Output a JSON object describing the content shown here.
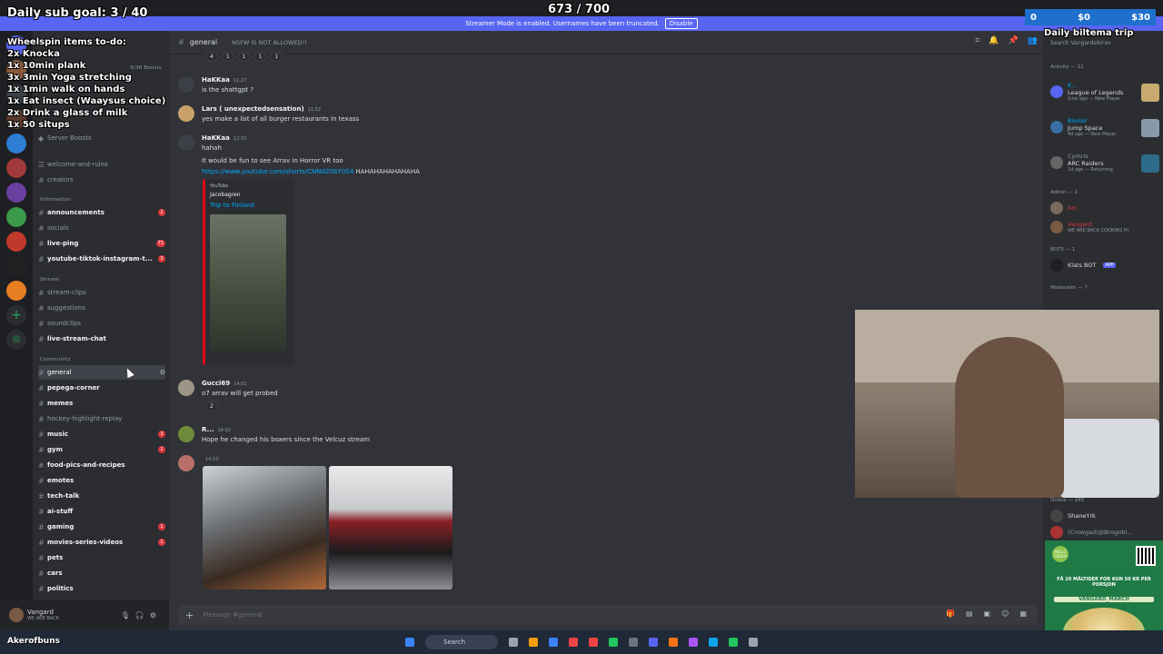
{
  "overlay": {
    "sub_goal": "Daily sub goal: 3 / 40",
    "counter": "673 / 700",
    "trip": "Daily biltema trip",
    "donate": [
      "0",
      "$0",
      "$30"
    ],
    "todo": [
      "Wheelspin items to-do:",
      "2x Knocka",
      "1x 10min plank",
      "3x 3min Yoga stretching",
      "1x 1min walk on hands",
      "1x Eat insect (Waaysus choice)",
      "2x Drink a glass of milk",
      "1x 50 situps"
    ],
    "bottom_name": "Akerofbuns"
  },
  "streamer_bar": {
    "text": "Streamer Mode is enabled. Usernames have been truncated.",
    "button": "Disable"
  },
  "sidebar": {
    "boosts": "Server Boosts",
    "boost_count": "9/36 Boosts",
    "top_channels": [
      "welcome-and-rules",
      "creators"
    ],
    "categories": {
      "information": "Information",
      "stream": "Stream",
      "community": "Community"
    },
    "information": [
      {
        "label": "announcements",
        "badge": "2"
      },
      {
        "label": "socials",
        "badge": ""
      },
      {
        "label": "live-ping",
        "badge": "71"
      },
      {
        "label": "youtube-tiktok-instagram-t...",
        "badge": "3"
      }
    ],
    "stream": [
      {
        "label": "stream-clips",
        "badge": ""
      },
      {
        "label": "suggestions",
        "badge": ""
      },
      {
        "label": "soundclips",
        "badge": ""
      },
      {
        "label": "live-stream-chat",
        "badge": ""
      }
    ],
    "community": [
      {
        "label": "general",
        "badge": ""
      },
      {
        "label": "pepega-corner",
        "badge": ""
      },
      {
        "label": "memes",
        "badge": ""
      },
      {
        "label": "hockey-highlight-replay",
        "badge": ""
      },
      {
        "label": "music",
        "badge": "3"
      },
      {
        "label": "gym",
        "badge": "1"
      },
      {
        "label": "food-pics-and-recipes",
        "badge": ""
      },
      {
        "label": "emotes",
        "badge": ""
      },
      {
        "label": "tech-talk",
        "badge": ""
      },
      {
        "label": "ai-stuff",
        "badge": ""
      },
      {
        "label": "gaming",
        "badge": "1"
      },
      {
        "label": "movies-series-videos",
        "badge": "1"
      },
      {
        "label": "pets",
        "badge": ""
      },
      {
        "label": "cars",
        "badge": ""
      },
      {
        "label": "politics",
        "badge": ""
      }
    ],
    "user": {
      "name": "Vangard",
      "status": "WE ARE BACK"
    }
  },
  "header": {
    "channel": "general",
    "topic": "NSFW IS NOT ALLOWED!!",
    "search": "Search VangardsArrav"
  },
  "top_reactions": [
    "4",
    "1",
    "1",
    "1",
    "1"
  ],
  "messages": [
    {
      "author": "HaKKaa",
      "time": "11:27",
      "text": "is the shattgpt ?"
    },
    {
      "author": "Lars ( unexpectedsensation)",
      "time": "11:52",
      "text": "yes make a list of all burger restaurants in texass"
    },
    {
      "author": "HaKKaa",
      "time": "12:33",
      "text": "hahah"
    },
    {
      "author": "",
      "time": "",
      "text": "It would be fun to see Arrav in Horror VR too"
    },
    {
      "author": "",
      "time": "",
      "text": "https://www.youtube.com/shorts/CNNdZ0bY0S4",
      "extra": "HAHAHAHAHAHAHA"
    },
    {
      "author": "Gucci69",
      "time": "14:01",
      "text": "o7 arrav will get probed"
    },
    {
      "author": "R...",
      "time": "14:02",
      "text": "Hope he changed his boxers since the Velcuz stream"
    },
    {
      "author": "",
      "time": "14:10",
      "text": ""
    }
  ],
  "embed": {
    "provider": "YouTube",
    "author": "Jacobagren",
    "title": "Trip to Finland"
  },
  "gucci_reaction": "2",
  "composer": {
    "placeholder": "Message #general"
  },
  "members": {
    "activity_title": "Activity — 12",
    "activity": [
      {
        "name": "K...",
        "game": "League of Legends",
        "sub": "1mo ago — New Player"
      },
      {
        "name": "Booter",
        "game": "Jump Space",
        "sub": "4d ago — New Player"
      },
      {
        "name": "Cymris",
        "game": "ARC Raiders",
        "sub": "1d ago — Returning"
      }
    ],
    "admin_title": "Admin — 2",
    "admin": [
      "Arr...",
      "Vangard"
    ],
    "admin_status": "WE ARE BACK COOKING HI",
    "bots_title": "BOTS — 1",
    "bot": "Klats BOT",
    "bot_tag": "APP",
    "moderator_title": "Moderator — 7",
    "online_title": "Online — 245",
    "online": [
      "ShaneYrk",
      "(Crowgad)@Brogobl..."
    ]
  },
  "ad": {
    "brand": "HELLO FRESH",
    "text": "FÅ 20 MÅLTIDER FOR KUN 50 KR PER PORSJON",
    "code": "VANGARD_MARCH"
  },
  "taskbar": {
    "search": "Search"
  },
  "colors": {
    "accent": "#5865f2",
    "link": "#00a8fc",
    "badge": "#da373c"
  }
}
